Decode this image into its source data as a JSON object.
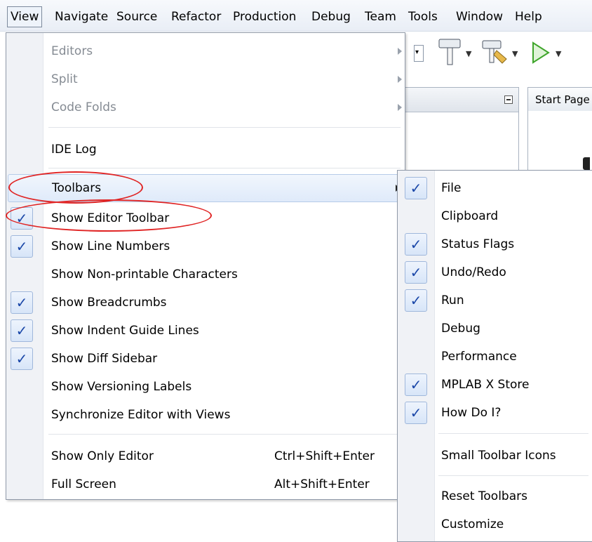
{
  "menubar": {
    "items": [
      "View",
      "Navigate",
      "Source",
      "Refactor",
      "Production",
      "Debug",
      "Team",
      "Tools",
      "Window",
      "Help"
    ]
  },
  "background": {
    "start_tab": "Start Page"
  },
  "view_menu": {
    "editors": "Editors",
    "split": "Split",
    "code_folds": "Code Folds",
    "ide_log": "IDE Log",
    "toolbars": "Toolbars",
    "show_editor_toolbar": "Show Editor Toolbar",
    "show_line_numbers": "Show Line Numbers",
    "show_non_printable": "Show Non-printable Characters",
    "show_breadcrumbs": "Show Breadcrumbs",
    "show_indent_guides": "Show Indent Guide Lines",
    "show_diff_sidebar": "Show Diff Sidebar",
    "show_versioning_labels": "Show Versioning Labels",
    "synchronize_editor": "Synchronize Editor with Views",
    "show_only_editor": "Show Only Editor",
    "show_only_editor_shortcut": "Ctrl+Shift+Enter",
    "full_screen": "Full Screen",
    "full_screen_shortcut": "Alt+Shift+Enter",
    "checked": {
      "show_editor_toolbar": true,
      "show_line_numbers": true,
      "show_non_printable": false,
      "show_breadcrumbs": true,
      "show_indent_guides": true,
      "show_diff_sidebar": true,
      "show_versioning_labels": false,
      "synchronize_editor": false
    }
  },
  "toolbars_submenu": {
    "items": [
      {
        "label": "File",
        "checked": true
      },
      {
        "label": "Clipboard",
        "checked": false
      },
      {
        "label": "Status Flags",
        "checked": true
      },
      {
        "label": "Undo/Redo",
        "checked": true
      },
      {
        "label": "Run",
        "checked": true
      },
      {
        "label": "Debug",
        "checked": false
      },
      {
        "label": "Performance",
        "checked": false
      },
      {
        "label": "MPLAB X Store",
        "checked": true
      },
      {
        "label": "How Do I?",
        "checked": true
      }
    ],
    "small_icons": "Small Toolbar Icons",
    "reset": "Reset Toolbars",
    "customize": "Customize"
  },
  "check_glyph": "✓",
  "colors": {
    "annotation": "#e02424",
    "check": "#1a47a8",
    "highlight": "#dfeafa"
  }
}
